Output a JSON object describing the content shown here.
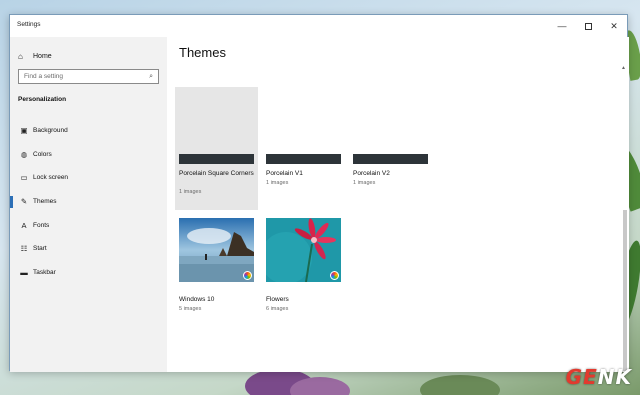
{
  "window": {
    "title": "Settings",
    "minimize_symbol": "—",
    "close_symbol": "✕"
  },
  "sidebar": {
    "home_label": "Home",
    "home_icon": "⌂",
    "search_placeholder": "Find a setting",
    "search_icon": "⌕",
    "section_title": "Personalization",
    "items": [
      {
        "label": "Background",
        "icon": "▣",
        "icon_name": "background-icon"
      },
      {
        "label": "Colors",
        "icon": "◍",
        "icon_name": "colors-icon"
      },
      {
        "label": "Lock screen",
        "icon": "▭",
        "icon_name": "lock-screen-icon"
      },
      {
        "label": "Themes",
        "icon": "✎",
        "icon_name": "themes-icon",
        "active": true
      },
      {
        "label": "Fonts",
        "icon": "A",
        "icon_name": "fonts-icon"
      },
      {
        "label": "Start",
        "icon": "☷",
        "icon_name": "start-icon"
      },
      {
        "label": "Taskbar",
        "icon": "▬",
        "icon_name": "taskbar-icon"
      }
    ]
  },
  "main": {
    "title": "Themes",
    "themes": [
      {
        "name": "Porcelain Square Corners",
        "count": "1 images"
      },
      {
        "name": "Porcelain V1",
        "count": "1 images"
      },
      {
        "name": "Porcelain V2",
        "count": "1 images"
      },
      {
        "name": "Windows 10",
        "count": "5 images"
      },
      {
        "name": "Flowers",
        "count": "6 images"
      }
    ]
  },
  "watermark": {
    "text_accent": "GE",
    "text_rest": "NK"
  },
  "colors": {
    "accent": "#2c6fb6",
    "bar": "#2d3439"
  }
}
